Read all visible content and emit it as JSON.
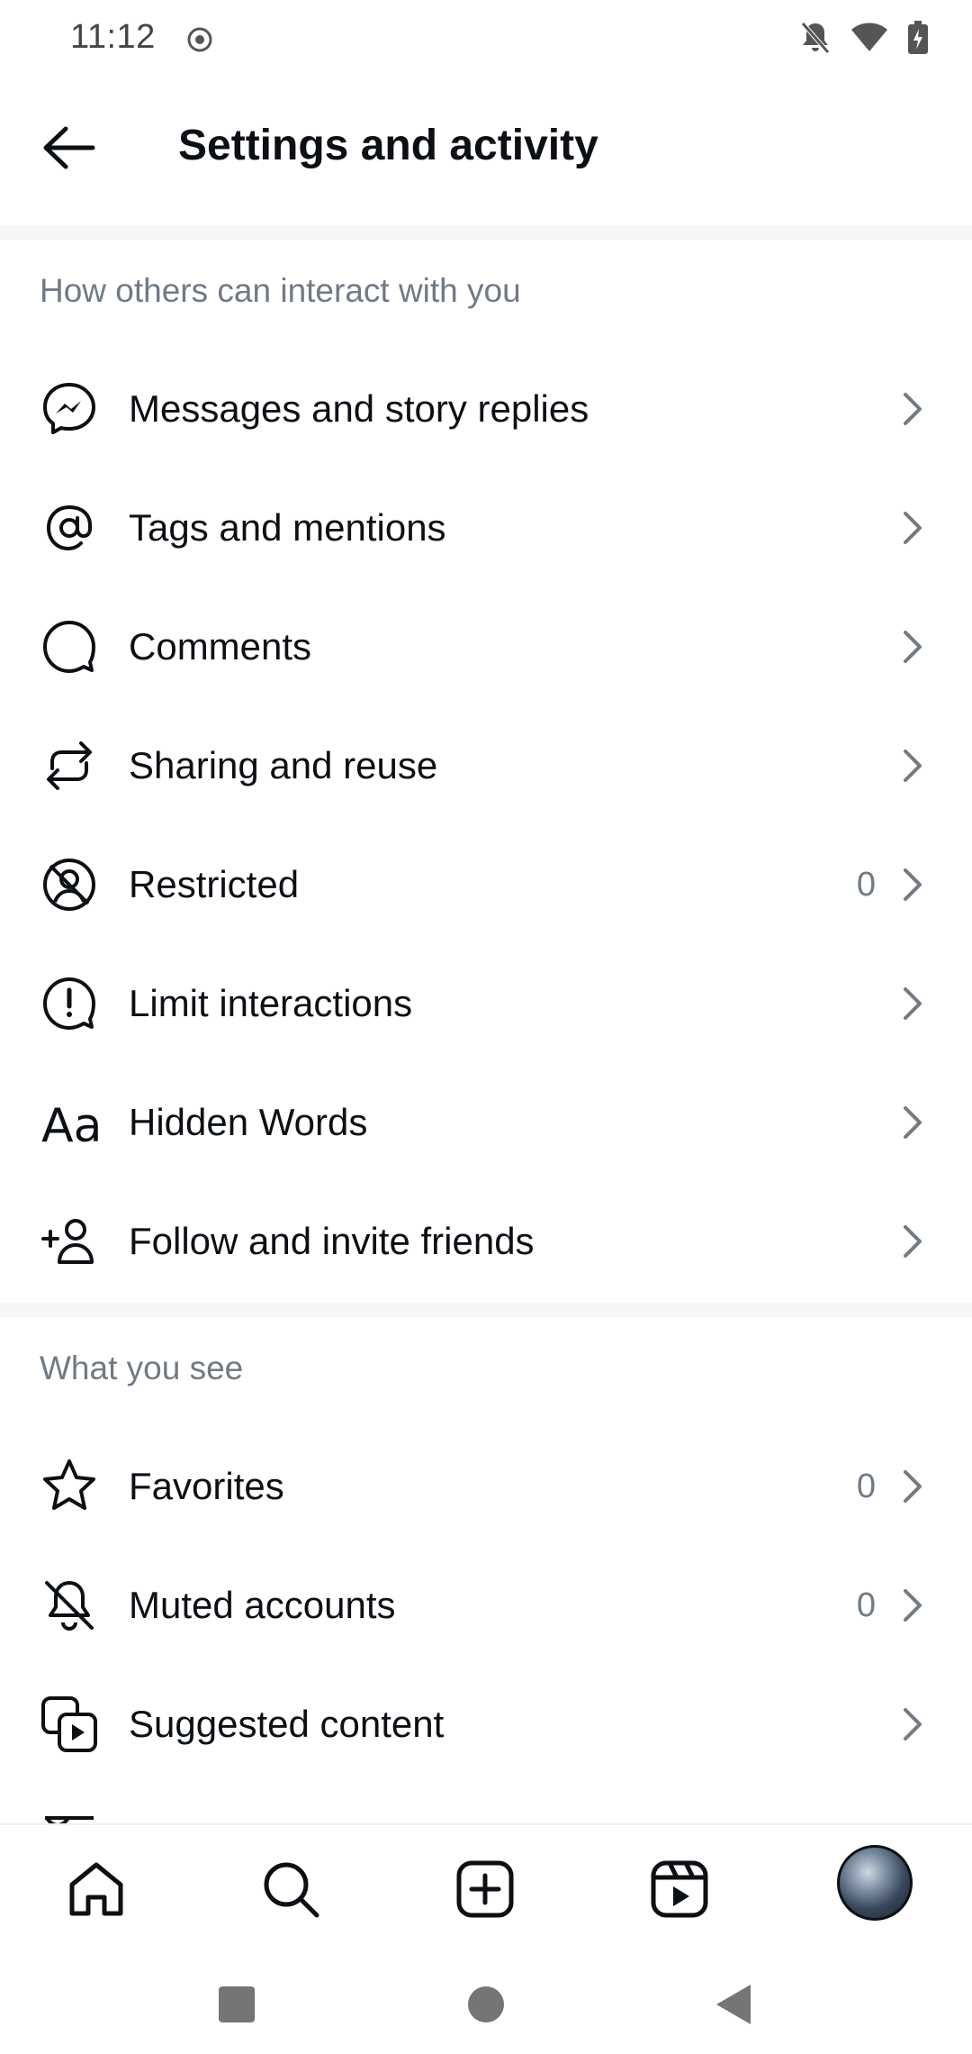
{
  "status_bar": {
    "time": "11:12"
  },
  "header": {
    "title": "Settings and activity",
    "back_icon": "arrow-left-icon"
  },
  "sections": [
    {
      "title": "How others can interact with you",
      "items": [
        {
          "label": "Messages and story replies",
          "icon": "messenger-icon",
          "count": ""
        },
        {
          "label": "Tags and mentions",
          "icon": "at-sign-icon",
          "count": ""
        },
        {
          "label": "Comments",
          "icon": "comment-bubble-icon",
          "count": ""
        },
        {
          "label": "Sharing and reuse",
          "icon": "repost-icon",
          "count": ""
        },
        {
          "label": "Restricted",
          "icon": "restricted-user-icon",
          "count": "0"
        },
        {
          "label": "Limit interactions",
          "icon": "alert-bubble-icon",
          "count": ""
        },
        {
          "label": "Hidden Words",
          "icon": "text-aa-icon",
          "count": ""
        },
        {
          "label": "Follow and invite friends",
          "icon": "add-person-icon",
          "count": ""
        }
      ]
    },
    {
      "title": "What you see",
      "items": [
        {
          "label": "Favorites",
          "icon": "star-icon",
          "count": "0"
        },
        {
          "label": "Muted accounts",
          "icon": "bell-off-icon",
          "count": "0"
        },
        {
          "label": "Suggested content",
          "icon": "suggested-media-icon",
          "count": ""
        }
      ]
    }
  ],
  "bottom_nav": [
    "home-icon",
    "search-icon",
    "create-plus-icon",
    "reels-icon",
    "profile-avatar"
  ],
  "system_nav": [
    "recents-square",
    "home-circle",
    "back-triangle"
  ],
  "colors": {
    "text": "#0c1014",
    "secondary": "#707a85",
    "divider": "#f4f6f7"
  }
}
